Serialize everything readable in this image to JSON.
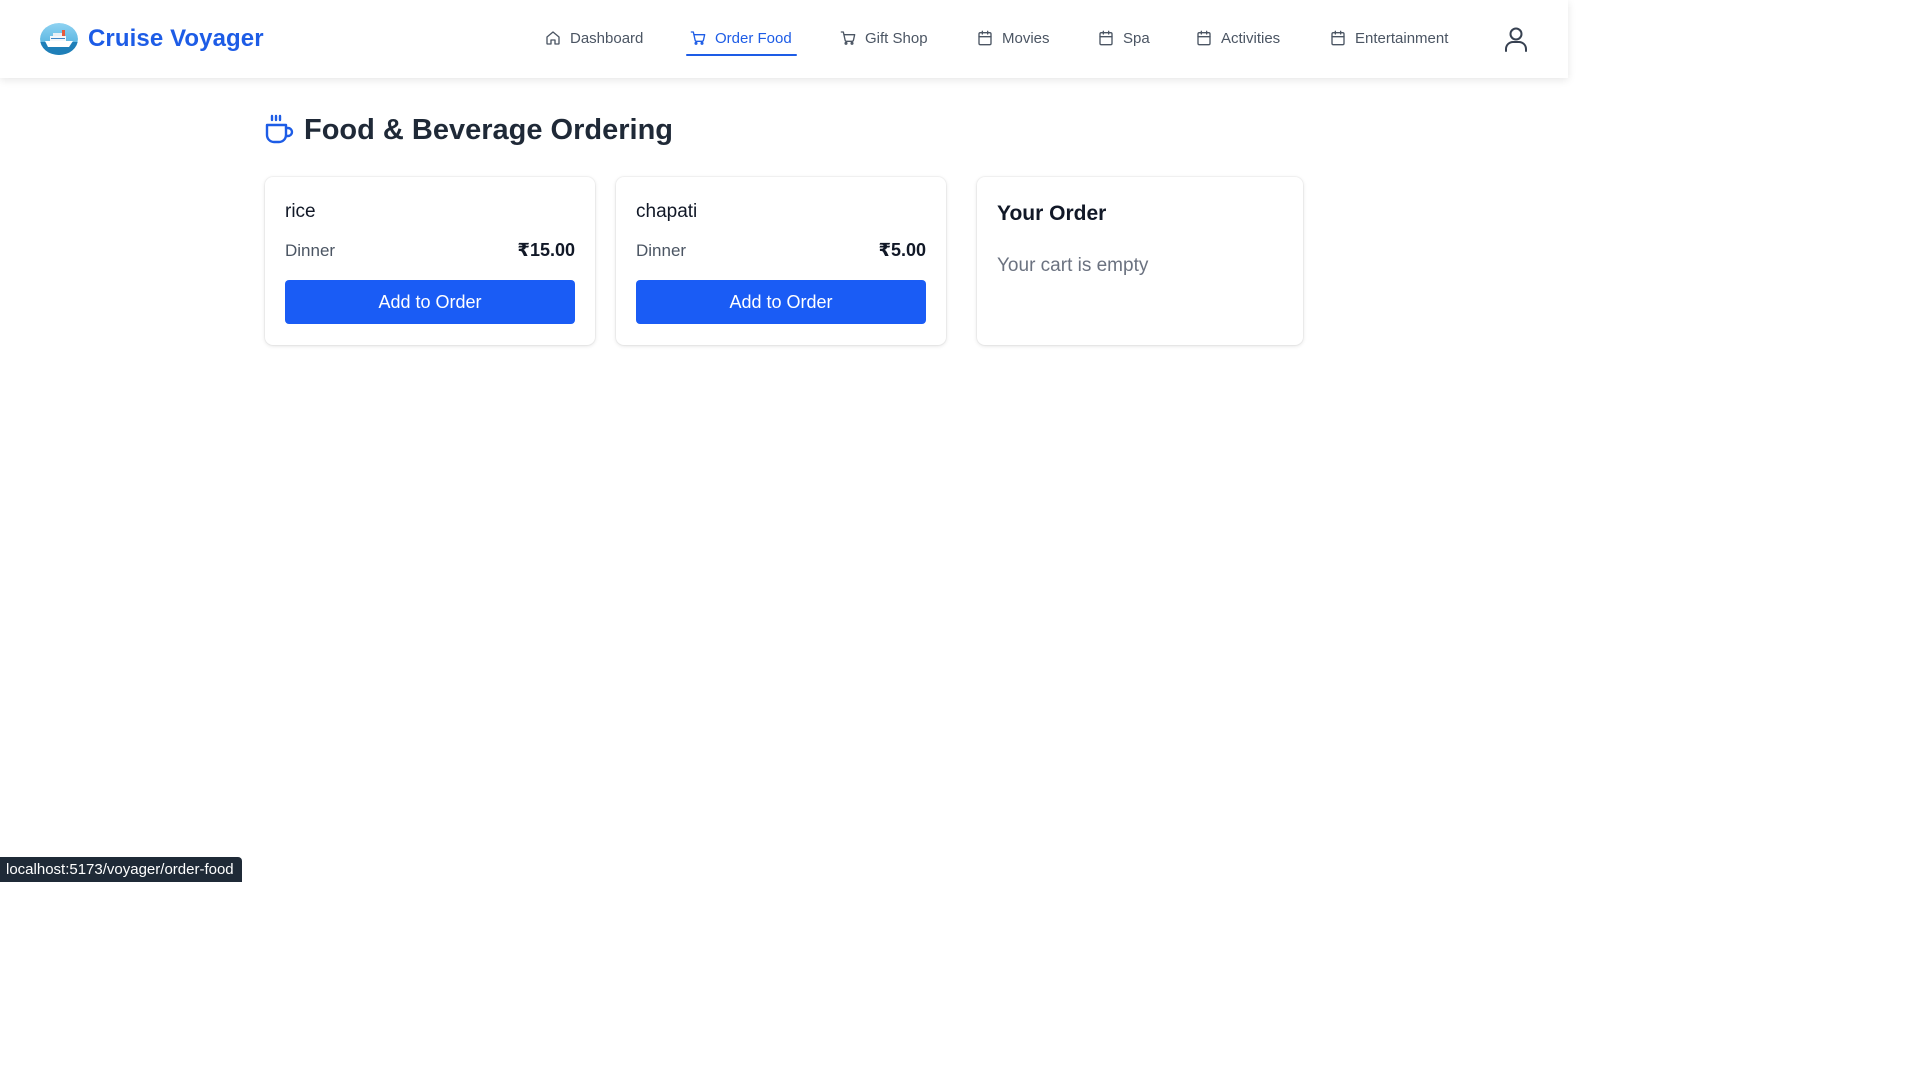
{
  "brand": {
    "name": "Cruise Voyager"
  },
  "nav": {
    "items": [
      {
        "label": "Dashboard",
        "icon": "home-icon"
      },
      {
        "label": "Order Food",
        "icon": "cart-icon",
        "active": true
      },
      {
        "label": "Gift Shop",
        "icon": "cart-icon"
      },
      {
        "label": "Movies",
        "icon": "calendar-icon"
      },
      {
        "label": "Spa",
        "icon": "calendar-icon"
      },
      {
        "label": "Activities",
        "icon": "calendar-icon"
      },
      {
        "label": "Entertainment",
        "icon": "calendar-icon"
      }
    ],
    "profile_icon": "user-icon"
  },
  "page": {
    "title": "Food & Beverage Ordering",
    "icon": "coffee-cup-icon"
  },
  "menu": {
    "items": [
      {
        "name": "rice",
        "category": "Dinner",
        "price": "₹15.00",
        "button": "Add to Order"
      },
      {
        "name": "chapati",
        "category": "Dinner",
        "price": "₹5.00",
        "button": "Add to Order"
      }
    ]
  },
  "order": {
    "title": "Your Order",
    "empty_text": "Your cart is empty"
  },
  "status_bar": {
    "url": "localhost:5173/voyager/order-food"
  },
  "colors": {
    "accent": "#1d5ce6",
    "button": "#1a5cf5",
    "text": "#1f2937",
    "muted": "#6b7280"
  }
}
